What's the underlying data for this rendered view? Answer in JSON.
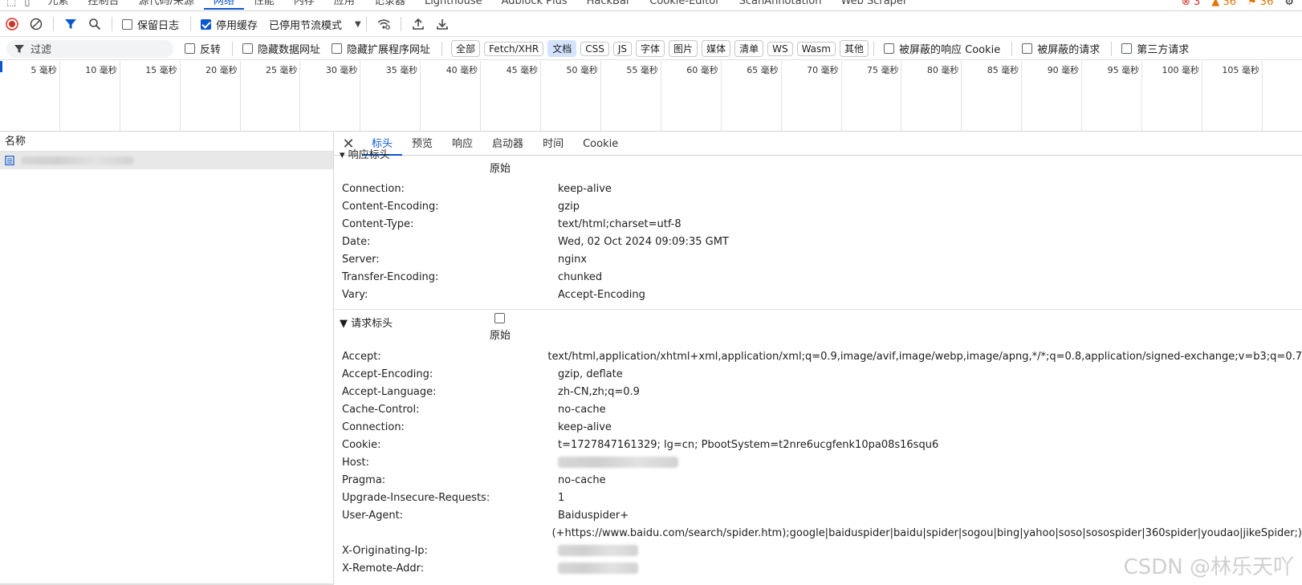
{
  "top_tabs": [
    "元素",
    "控制台",
    "源代码/来源",
    "网络",
    "性能",
    "内存",
    "应用",
    "记录器",
    "Lighthouse",
    "Adblock Plus",
    "HackBar",
    "Cookie-Editor",
    "ScanAnnotation",
    "Web Scraper"
  ],
  "top_counts": {
    "errors": "3",
    "warnings": "36",
    "issues": "36"
  },
  "toolbar": {
    "preserve_log": "保留日志",
    "disable_cache": "停用缓存",
    "throttling": "已停用节流模式"
  },
  "filter": {
    "placeholder": "过滤",
    "invert": "反转",
    "hide_data_urls": "隐藏数据网址",
    "hide_extension_urls": "隐藏扩展程序网址",
    "types": [
      "全部",
      "Fetch/XHR",
      "文档",
      "CSS",
      "JS",
      "字体",
      "图片",
      "媒体",
      "清单",
      "WS",
      "Wasm",
      "其他"
    ],
    "blocked_response_cookies": "被屏蔽的响应 Cookie",
    "blocked_requests": "被屏蔽的请求",
    "third_party": "第三方请求"
  },
  "timeline_ticks": [
    "5 毫秒",
    "10 毫秒",
    "15 毫秒",
    "20 毫秒",
    "25 毫秒",
    "30 毫秒",
    "35 毫秒",
    "40 毫秒",
    "45 毫秒",
    "50 毫秒",
    "55 毫秒",
    "60 毫秒",
    "65 毫秒",
    "70 毫秒",
    "75 毫秒",
    "80 毫秒",
    "85 毫秒",
    "90 毫秒",
    "95 毫秒",
    "100 毫秒",
    "105 毫秒"
  ],
  "list": {
    "header": "名称"
  },
  "detail_tabs": [
    "标头",
    "预览",
    "响应",
    "启动器",
    "时间",
    "Cookie"
  ],
  "response_headers": {
    "title": "▾ 响应标头",
    "raw_label": "原始",
    "rows": [
      {
        "name": "Connection:",
        "value": "keep-alive"
      },
      {
        "name": "Content-Encoding:",
        "value": "gzip"
      },
      {
        "name": "Content-Type:",
        "value": "text/html;charset=utf-8"
      },
      {
        "name": "Date:",
        "value": "Wed, 02 Oct 2024 09:09:35 GMT"
      },
      {
        "name": "Server:",
        "value": "nginx"
      },
      {
        "name": "Transfer-Encoding:",
        "value": "chunked"
      },
      {
        "name": "Vary:",
        "value": "Accept-Encoding"
      }
    ]
  },
  "request_headers": {
    "title": "▼ 请求标头",
    "raw_label": "原始",
    "rows": [
      {
        "name": "Accept:",
        "value": "text/html,application/xhtml+xml,application/xml;q=0.9,image/avif,image/webp,image/apng,*/*;q=0.8,application/signed-exchange;v=b3;q=0.7"
      },
      {
        "name": "Accept-Encoding:",
        "value": "gzip, deflate"
      },
      {
        "name": "Accept-Language:",
        "value": "zh-CN,zh;q=0.9"
      },
      {
        "name": "Cache-Control:",
        "value": "no-cache"
      },
      {
        "name": "Connection:",
        "value": "keep-alive"
      },
      {
        "name": "Cookie:",
        "value": "t=1727847161329; lg=cn; PbootSystem=t2nre6ucgfenk10pa08s16squ6"
      },
      {
        "name": "Host:",
        "value": ""
      },
      {
        "name": "Pragma:",
        "value": "no-cache"
      },
      {
        "name": "Upgrade-Insecure-Requests:",
        "value": "1"
      },
      {
        "name": "User-Agent:",
        "value": "Baiduspider+"
      },
      {
        "name": "",
        "value": "(+https://www.baidu.com/search/spider.htm);google|baiduspider|baidu|spider|sogou|bing|yahoo|soso|sosospider|360spider|youdao|jikeSpider;)"
      },
      {
        "name": "X-Originating-Ip:",
        "value": ""
      },
      {
        "name": "X-Remote-Addr:",
        "value": ""
      }
    ]
  },
  "watermark": "CSDN @林乐天吖"
}
